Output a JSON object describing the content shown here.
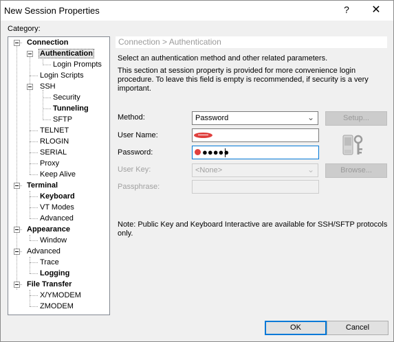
{
  "window": {
    "title": "New Session Properties",
    "help_glyph": "?",
    "close_glyph": "✕"
  },
  "category_label": "Category:",
  "tree": [
    {
      "label": "Connection",
      "bold": true
    },
    {
      "label": "Authentication",
      "bold": true,
      "selected": true
    },
    {
      "label": "Login Prompts",
      "bold": false
    },
    {
      "label": "Login Scripts",
      "bold": false
    },
    {
      "label": "SSH",
      "bold": false
    },
    {
      "label": "Security",
      "bold": false
    },
    {
      "label": "Tunneling",
      "bold": true
    },
    {
      "label": "SFTP",
      "bold": false
    },
    {
      "label": "TELNET",
      "bold": false
    },
    {
      "label": "RLOGIN",
      "bold": false
    },
    {
      "label": "SERIAL",
      "bold": false
    },
    {
      "label": "Proxy",
      "bold": false
    },
    {
      "label": "Keep Alive",
      "bold": false
    },
    {
      "label": "Terminal",
      "bold": true
    },
    {
      "label": "Keyboard",
      "bold": true
    },
    {
      "label": "VT Modes",
      "bold": false
    },
    {
      "label": "Advanced",
      "bold": false
    },
    {
      "label": "Appearance",
      "bold": true
    },
    {
      "label": "Window",
      "bold": false
    },
    {
      "label": "Advanced",
      "bold": false
    },
    {
      "label": "Trace",
      "bold": false
    },
    {
      "label": "Logging",
      "bold": true
    },
    {
      "label": "File Transfer",
      "bold": true
    },
    {
      "label": "X/YMODEM",
      "bold": false
    },
    {
      "label": "ZMODEM",
      "bold": false
    }
  ],
  "panel": {
    "header": "Connection > Authentication",
    "desc1": "Select an authentication method and other related parameters.",
    "desc2": "This section at session property is provided for more convenience login procedure. To leave this field is empty is recommended, if security is a very important.",
    "method_label": "Method:",
    "method_value": "Password",
    "username_label": "User Name:",
    "password_label": "Password:",
    "password_mask": "●●●●●",
    "userkey_label": "User Key:",
    "userkey_value": "<None>",
    "passphrase_label": "Passphrase:",
    "setup_button": "Setup...",
    "browse_button": "Browse...",
    "note": "Note: Public Key and Keyboard Interactive are available for SSH/SFTP protocols only."
  },
  "buttons": {
    "ok": "OK",
    "cancel": "Cancel"
  },
  "colors": {
    "accent": "#0078d7",
    "redaction": "#e0403e"
  }
}
